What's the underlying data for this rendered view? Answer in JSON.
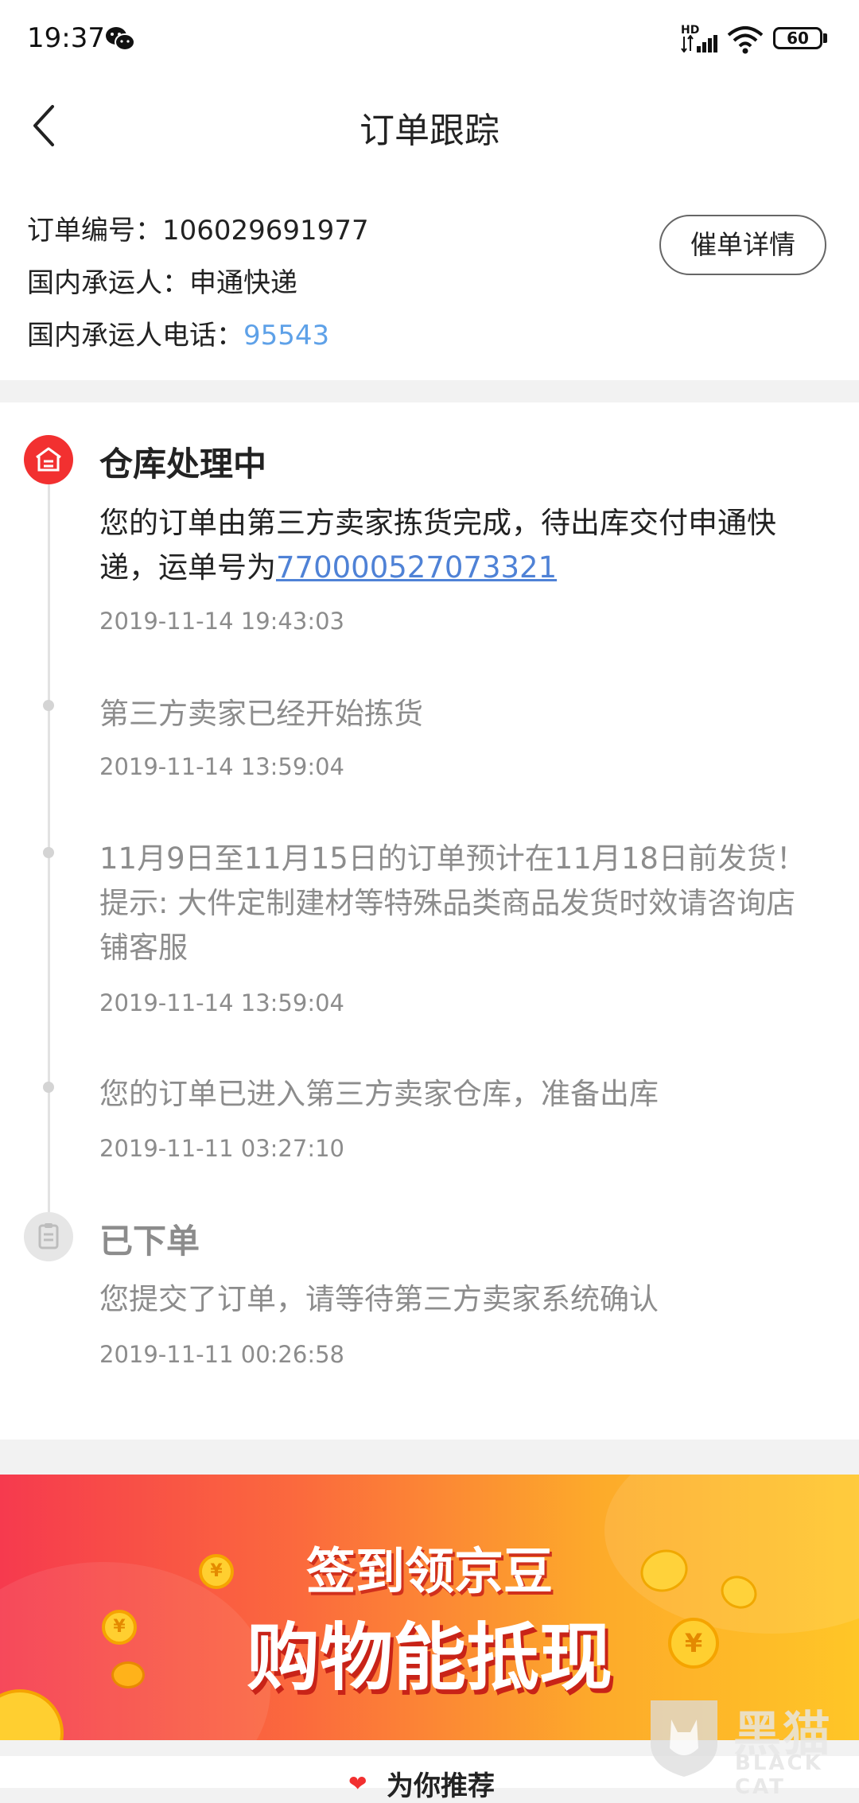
{
  "status_bar": {
    "time": "19:37",
    "network_type": "HD",
    "battery_level": "60",
    "icons": [
      "wechat-icon",
      "signal-icon",
      "wifi-icon",
      "battery-icon"
    ]
  },
  "nav": {
    "title": "订单跟踪",
    "back_icon": "chevron-left-icon"
  },
  "order_info": {
    "order_number_label": "订单编号：",
    "order_number": "106029691977",
    "carrier_label": "国内承运人：",
    "carrier": "申通快递",
    "carrier_phone_label": "国内承运人电话：",
    "carrier_phone": "95543",
    "urge_button_label": "催单详情"
  },
  "tracking": {
    "events": [
      {
        "title": "仓库处理中",
        "description": "您的订单由第三方卖家拣货完成，待出库交付申通快递，运单号为",
        "waybill_number": "770000527073321",
        "time": "2019-11-14 19:43:03",
        "icon": "warehouse-icon"
      },
      {
        "description": "第三方卖家已经开始拣货",
        "time": "2019-11-14 13:59:04"
      },
      {
        "description": "11月9日至11月15日的订单预计在11月18日前发货！提示: 大件定制建材等特殊品类商品发货时效请咨询店铺客服",
        "time": "2019-11-14 13:59:04"
      },
      {
        "description": "您的订单已进入第三方卖家仓库，准备出库",
        "time": "2019-11-11 03:27:10"
      },
      {
        "title": "已下单",
        "description": "您提交了订单，请等待第三方卖家系统确认",
        "time": "2019-11-11 00:26:58",
        "icon": "clipboard-icon"
      }
    ]
  },
  "banner": {
    "line1": "签到领京豆",
    "line2": "购物能抵现",
    "coin_symbol": "¥"
  },
  "recommend": {
    "label": "为你推荐",
    "icon": "heart-icon"
  },
  "watermark": {
    "cn": "黑猫",
    "en": "BLACK CAT"
  },
  "colors": {
    "accent_red": "#f23030",
    "link_blue": "#4f82d6",
    "phone_blue": "#5ea1e8",
    "muted_text": "#8c8c8c"
  }
}
